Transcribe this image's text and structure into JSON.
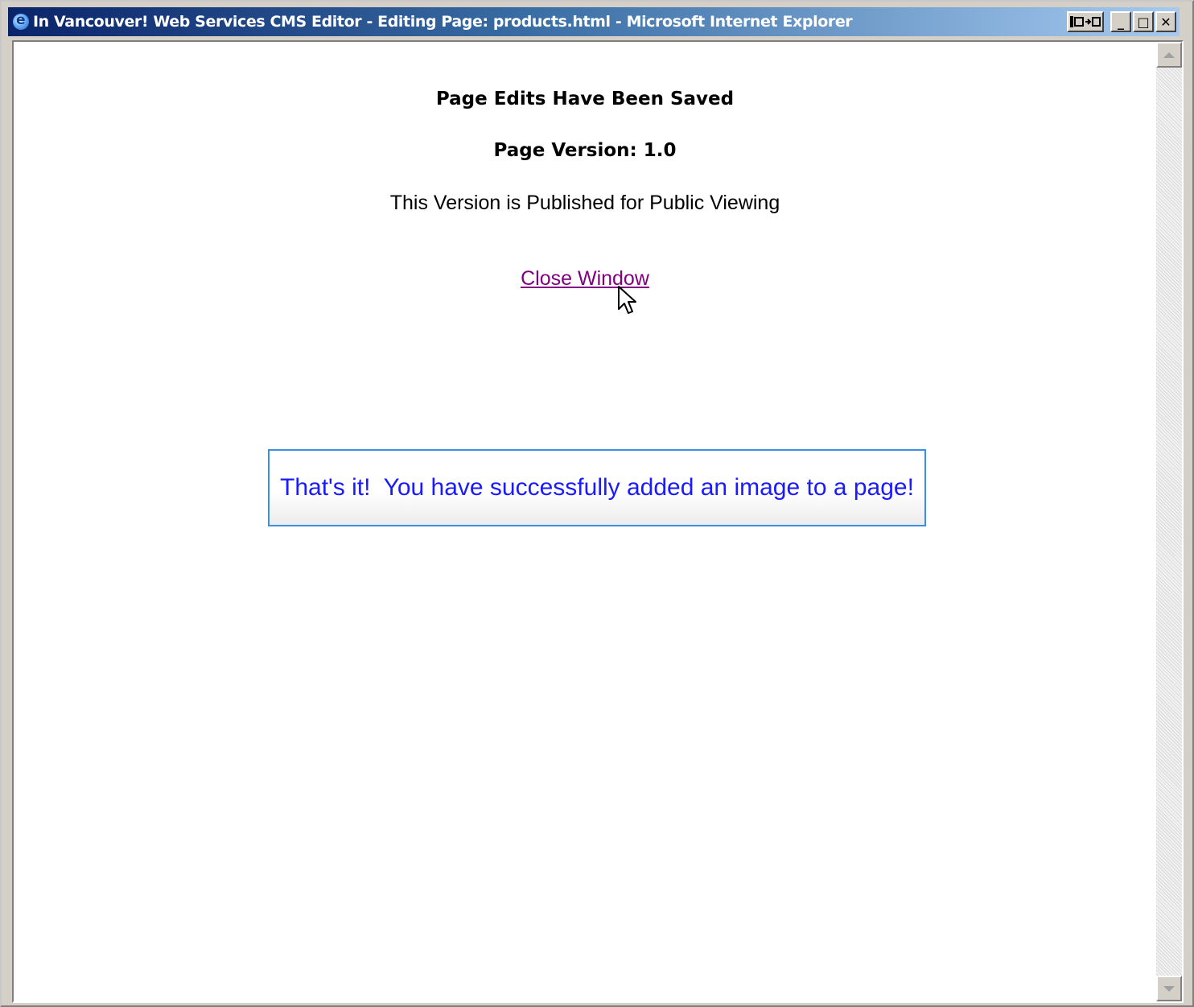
{
  "window": {
    "title": "In Vancouver! Web Services CMS Editor - Editing Page: products.html - Microsoft Internet Explorer",
    "buttons": {
      "minimize": "_",
      "maximize": "□",
      "close": "✕"
    }
  },
  "page": {
    "heading": "Page Edits Have Been Saved",
    "version": "Page Version: 1.0",
    "status": "This Version is Published for Public Viewing",
    "close_link": "Close Window"
  },
  "callout": {
    "text": "That's it!  You have successfully added an image to a page!"
  },
  "colors": {
    "link": "#800080",
    "callout_text": "#1a1aff",
    "callout_border": "#3b8ee0",
    "titlebar": "#0a246a"
  }
}
